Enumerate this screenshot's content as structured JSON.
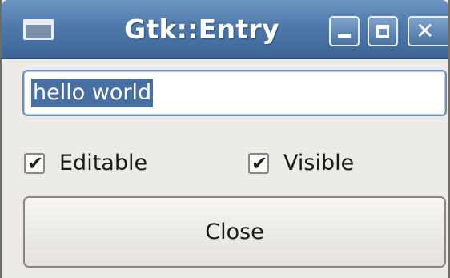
{
  "window": {
    "title": "Gtk::Entry",
    "icons": {
      "app": "window-icon",
      "minimize": "minimize-icon",
      "maximize": "maximize-icon",
      "close": "close-icon"
    }
  },
  "entry": {
    "value": "hello world",
    "selected": true
  },
  "options": {
    "editable": {
      "label": "Editable",
      "checked": true
    },
    "visible": {
      "label": "Visible",
      "checked": true
    }
  },
  "buttons": {
    "close_label": "Close"
  },
  "colors": {
    "titlebar": "#4f79ab",
    "selection": "#486fa1",
    "background": "#edebe8"
  }
}
